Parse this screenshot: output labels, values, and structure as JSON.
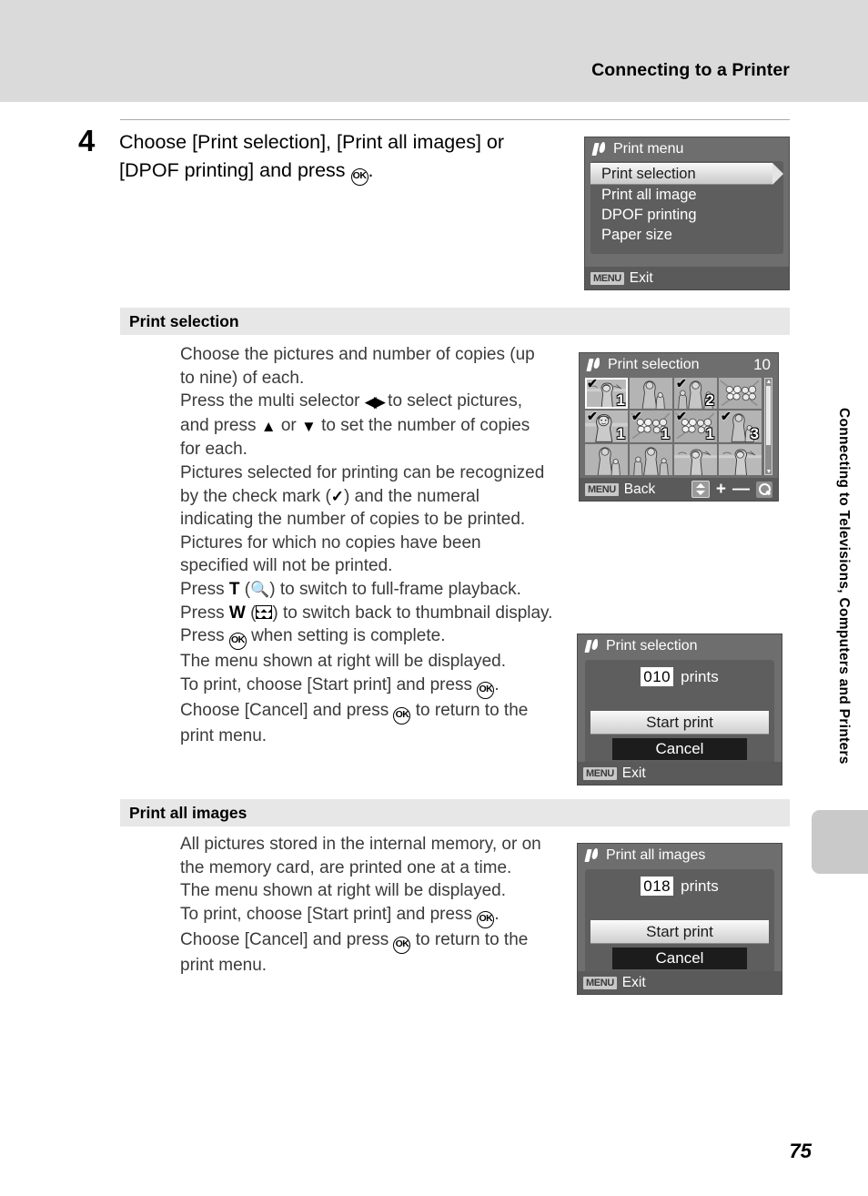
{
  "page": {
    "running_head": "Connecting to a Printer",
    "page_number": "75",
    "side_text": "Connecting to Televisions, Computers and Printers"
  },
  "step": {
    "number": "4",
    "line1_a": "Choose [Print selection], [Print all images] or",
    "line2_a": "[DPOF printing] and press ",
    "line2_b": "OK",
    "line2_c": "."
  },
  "sections": {
    "print_selection": {
      "heading": "Print selection",
      "lines": [
        "Choose the pictures and number of copies (up",
        "to nine) of each.",
        "Pictures for which no copies have been",
        "specified will not be printed.",
        "The menu shown at right will be displayed.",
        "print menu."
      ],
      "l_press_multi_a": "Press the multi selector ",
      "l_press_multi_b": " to select pictures,",
      "l_and_press_a": "and press ",
      "l_and_press_b": " or ",
      "l_and_press_c": " to set the number of copies",
      "l_for_each": "for each.",
      "l_recognized": "Pictures selected for printing can be recognized",
      "l_checkmark_a": "by the check mark (",
      "l_checkmark_b": ") and the numeral",
      "l_indicating": "indicating the number of copies to be printed.",
      "l_press_t_a": "Press ",
      "l_press_t_b": "T",
      "l_press_t_c": " (",
      "l_press_t_d": ") to switch to full-frame playback.",
      "l_press_w_a": "Press ",
      "l_press_w_b": "W",
      "l_press_w_c": " (",
      "l_press_w_d": ") to switch back to thumbnail display.",
      "l_press_ok_a": "Press ",
      "l_press_ok_b": "OK",
      "l_press_ok_c": " when setting is complete.",
      "l_toprint_a": "To print, choose [Start print] and press ",
      "l_toprint_b": "OK",
      "l_toprint_c": ".",
      "l_cancel_a": "Choose [Cancel] and press ",
      "l_cancel_b": "OK",
      "l_cancel_c": " to return to the"
    },
    "print_all": {
      "heading": "Print all images",
      "l1": "All pictures stored in the internal memory, or on",
      "l2": "the memory card, are printed one at a time.",
      "l3": "The menu shown at right will be displayed.",
      "l4_a": "To print, choose [Start print] and press ",
      "l4_b": "OK",
      "l4_c": ".",
      "l5_a": "Choose [Cancel] and press ",
      "l5_b": "OK",
      "l5_c": " to return to the",
      "l6": "print menu."
    }
  },
  "screens": {
    "print_menu": {
      "title": "Print menu",
      "items": [
        {
          "label": "Print selection",
          "selected": true
        },
        {
          "label": "Print all image",
          "selected": false
        },
        {
          "label": "DPOF printing",
          "selected": false
        },
        {
          "label": "Paper size",
          "selected": false
        }
      ],
      "foot_badge": "MENU",
      "foot_label": "Exit"
    },
    "print_selection_grid": {
      "title": "Print selection",
      "count": "10",
      "foot_badge": "MENU",
      "foot_label": "Back",
      "plus": "+",
      "minus": "—",
      "cells": [
        {
          "art": "woman-beach",
          "checked": true,
          "qty": "1",
          "current": true
        },
        {
          "art": "woman-child",
          "checked": false,
          "qty": "",
          "current": false
        },
        {
          "art": "family",
          "checked": true,
          "qty": "2",
          "current": false
        },
        {
          "art": "flowers",
          "checked": false,
          "qty": "",
          "current": false
        },
        {
          "art": "portrait",
          "checked": true,
          "qty": "1",
          "current": false
        },
        {
          "art": "flowers",
          "checked": true,
          "qty": "1",
          "current": false
        },
        {
          "art": "flowers",
          "checked": true,
          "qty": "1",
          "current": false
        },
        {
          "art": "woman-child",
          "checked": true,
          "qty": "3",
          "current": false
        },
        {
          "art": "woman-child",
          "checked": false,
          "qty": "",
          "current": false
        },
        {
          "art": "family",
          "checked": false,
          "qty": "",
          "current": false
        },
        {
          "art": "woman-beach",
          "checked": false,
          "qty": "",
          "current": false
        },
        {
          "art": "woman-beach",
          "checked": false,
          "qty": "",
          "current": false
        }
      ]
    },
    "print_selection_confirm": {
      "title": "Print selection",
      "count": "010",
      "prints_label": "prints",
      "start_label": "Start print",
      "cancel_label": "Cancel",
      "foot_badge": "MENU",
      "foot_label": "Exit"
    },
    "print_all_confirm": {
      "title": "Print all images",
      "count": "018",
      "prints_label": "prints",
      "start_label": "Start print",
      "cancel_label": "Cancel",
      "foot_badge": "MENU",
      "foot_label": "Exit"
    }
  },
  "colors": {
    "band": "#dadada",
    "section_bar": "#e7e7e7",
    "screen_bg": "#6e6e6e",
    "screen_panel": "#5e5e5e",
    "highlight": "#f6f6f6"
  }
}
